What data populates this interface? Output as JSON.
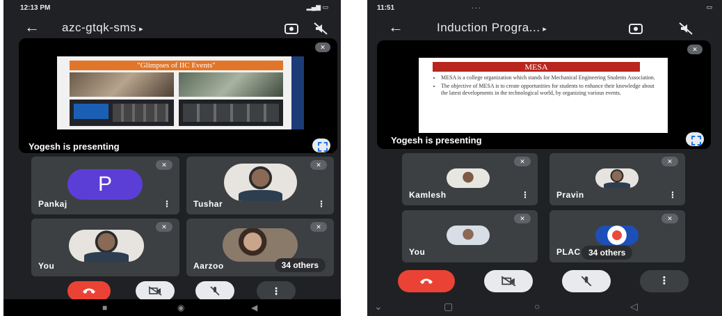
{
  "left": {
    "status_time": "12:13 PM",
    "meeting_title": "azc-gtqk-sms",
    "chevron": "▸",
    "slide_title": "\"Glimpses of IIC Events\"",
    "presenting_text": "Yogesh is presenting",
    "tiles": [
      {
        "name": "Pankaj",
        "avatar_letter": "P"
      },
      {
        "name": "Tushar"
      },
      {
        "name": "You"
      },
      {
        "name": "Aarzoo"
      }
    ],
    "others_label": "34 others",
    "more_glyph": "⋮",
    "muted_glyph": "✕"
  },
  "right": {
    "status_time": "11:51",
    "status_dots": "···",
    "meeting_title": "Induction Progra...",
    "chevron": "▸",
    "slide_title": "MESA",
    "slide_bullets": [
      "MESA is a college organization which stands for Mechanical Engineering Students Association.",
      "The objective of MESA is to create opportunities for students to enhance their knowledge about the latest developments in the technological world, by organizing various events."
    ],
    "presenting_text": "Yogesh is presenting",
    "tiles": [
      {
        "name": "Kamlesh"
      },
      {
        "name": "Pravin"
      },
      {
        "name": "You"
      },
      {
        "name": "PLAC"
      }
    ],
    "others_label": "34 others",
    "more_glyph": "⋮",
    "muted_glyph": "✕"
  },
  "controls": {
    "end_call_icon": "end-call-icon",
    "camera_off_icon": "camera-off-icon",
    "mic_off_icon": "mic-off-icon",
    "more_icon": "more-vert-icon"
  },
  "colors": {
    "background": "#202124",
    "tile": "#3c4043",
    "end_call": "#ea4335",
    "avatar_p": "#5b3ed6"
  }
}
